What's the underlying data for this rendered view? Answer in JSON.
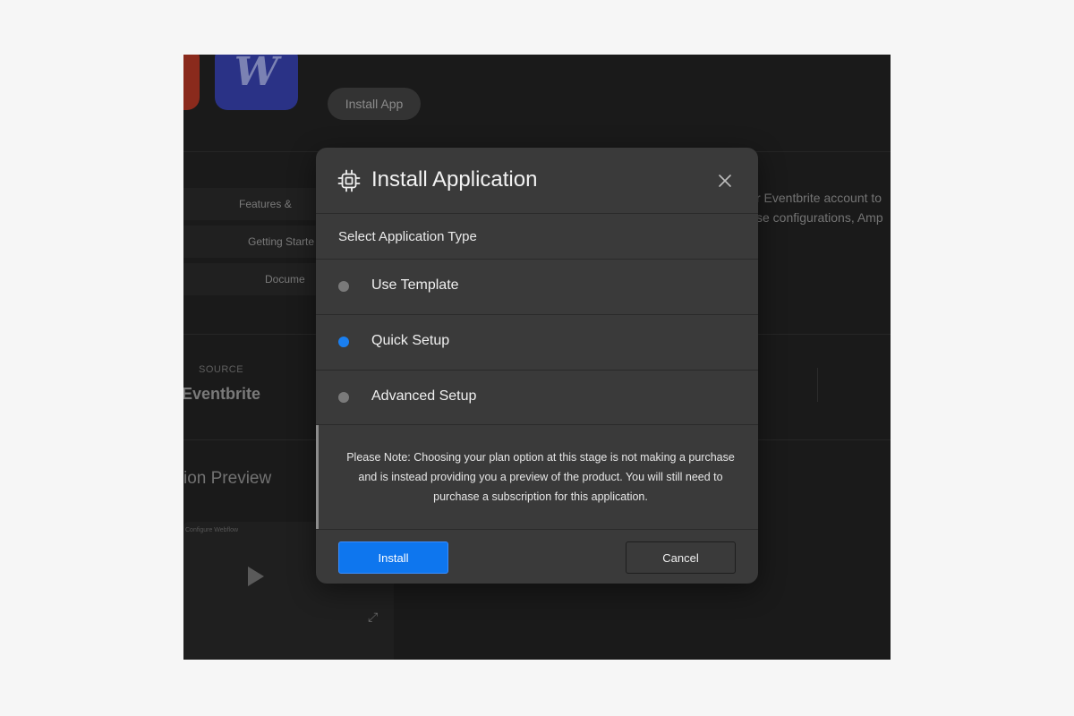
{
  "background": {
    "logo_letter": "W",
    "install_pill": "Install App",
    "tabs": [
      "Features & ",
      "Getting Starte",
      "Docume"
    ],
    "description_line1": "r Eventbrite account to",
    "description_line2": "se configurations, Amp",
    "source_label": "SOURCE",
    "source_value": "Eventbrite",
    "preview_title": "ion Preview",
    "video_title": "Configure Webflow",
    "play_glyph": "▶",
    "expand_glyph": "⤢"
  },
  "modal": {
    "title": "Install Application",
    "title_icon": "chip-icon",
    "close_icon": "close-icon",
    "section_label": "Select Application Type",
    "options": [
      {
        "label": "Use Template",
        "selected": false
      },
      {
        "label": "Quick Setup",
        "selected": true
      },
      {
        "label": "Advanced Setup",
        "selected": false
      }
    ],
    "note": "Please Note: Choosing your plan option at this stage is not making a purchase and is instead providing you a preview of the product. You will still need to purchase a subscription for this application.",
    "install_label": "Install",
    "cancel_label": "Cancel",
    "colors": {
      "accent": "#0e76ee",
      "selected_radio": "#1a7ff0",
      "unselected_radio": "#7a7a7a",
      "modal_bg": "#3a3a3a"
    }
  }
}
